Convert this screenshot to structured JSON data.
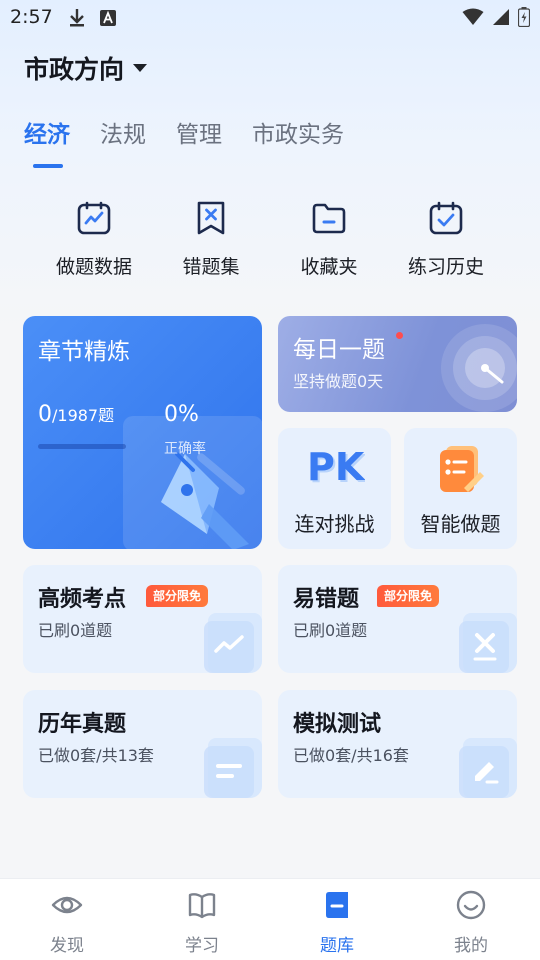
{
  "status_bar": {
    "time": "2:57"
  },
  "header": {
    "direction": "市政方向"
  },
  "tabs": [
    {
      "label": "经济",
      "active": true
    },
    {
      "label": "法规",
      "active": false
    },
    {
      "label": "管理",
      "active": false
    },
    {
      "label": "市政实务",
      "active": false
    }
  ],
  "quick_actions": [
    {
      "label": "做题数据",
      "icon": "chart-icon"
    },
    {
      "label": "错题集",
      "icon": "wrong-bookmark-icon"
    },
    {
      "label": "收藏夹",
      "icon": "folder-icon"
    },
    {
      "label": "练习历史",
      "icon": "calendar-check-icon"
    }
  ],
  "chapter_card": {
    "title": "章节精炼",
    "done": "0",
    "total": "/1987题",
    "progress": 0,
    "rate": "0%",
    "rate_label": "正确率"
  },
  "daily_card": {
    "title": "每日一题",
    "subtitle": "坚持做题0天"
  },
  "pk_card": {
    "label": "连对挑战",
    "icon_text": "PK"
  },
  "smart_card": {
    "label": "智能做题"
  },
  "list_cards": [
    {
      "title": "高频考点",
      "badge": "部分限免",
      "sub": "已刷0道题"
    },
    {
      "title": "易错题",
      "badge": "部分限免",
      "sub": "已刷0道题"
    },
    {
      "title": "历年真题",
      "sub": "已做0套/共13套"
    },
    {
      "title": "模拟测试",
      "sub": "已做0套/共16套"
    }
  ],
  "bottom_nav": [
    {
      "label": "发现",
      "active": false
    },
    {
      "label": "学习",
      "active": false
    },
    {
      "label": "题库",
      "active": true
    },
    {
      "label": "我的",
      "active": false
    }
  ],
  "colors": {
    "accent": "#2a73ee",
    "badge": "#ff5a3c"
  }
}
